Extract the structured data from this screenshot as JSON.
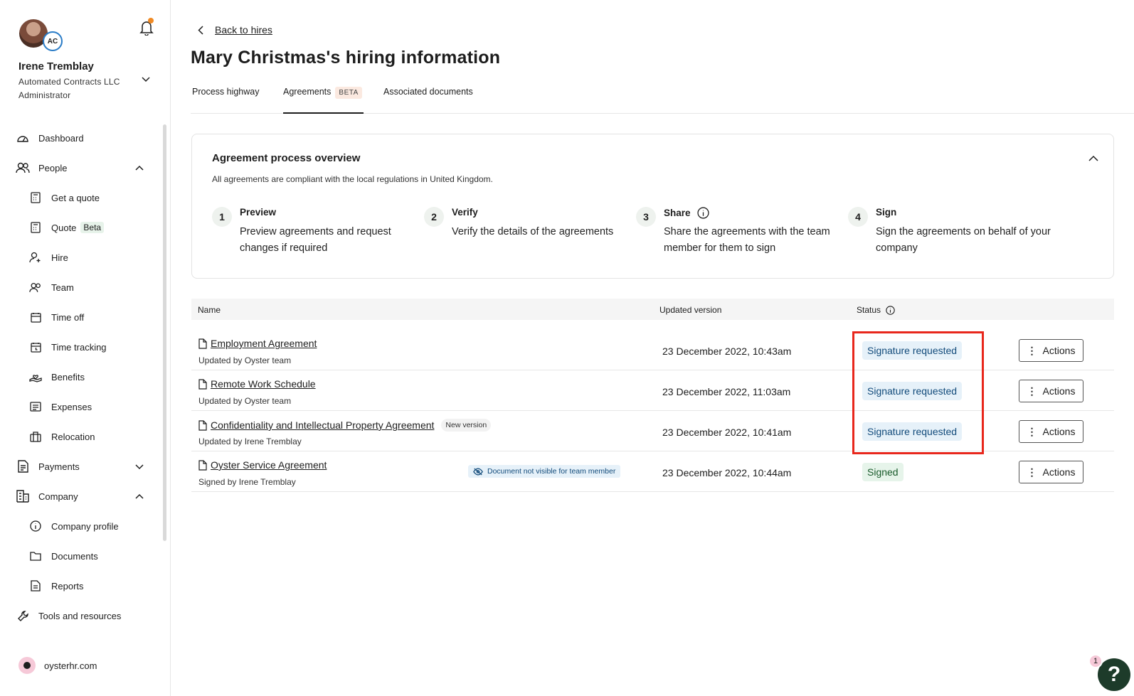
{
  "user": {
    "initials": "AC",
    "name": "Irene Tremblay",
    "company": "Automated Contracts LLC",
    "role": "Administrator"
  },
  "nav": {
    "dashboard": "Dashboard",
    "people": "People",
    "get_quote": "Get a quote",
    "quote": "Quote",
    "quote_badge": "Beta",
    "hire": "Hire",
    "team": "Team",
    "time_off": "Time off",
    "time_tracking": "Time tracking",
    "benefits": "Benefits",
    "expenses": "Expenses",
    "relocation": "Relocation",
    "payments": "Payments",
    "company": "Company",
    "company_profile": "Company profile",
    "documents": "Documents",
    "reports": "Reports",
    "tools": "Tools and resources"
  },
  "footer": {
    "site": "oysterhr.com"
  },
  "header": {
    "back_label": "Back to hires",
    "title": "Mary Christmas's hiring information"
  },
  "tabs": {
    "process": "Process highway",
    "agreements": "Agreements",
    "agreements_badge": "BETA",
    "associated": "Associated documents"
  },
  "overview": {
    "title": "Agreement process overview",
    "subtitle": "All agreements are compliant with the local regulations in United Kingdom.",
    "steps": [
      {
        "num": "1",
        "title": "Preview",
        "desc": "Preview agreements and request changes if required"
      },
      {
        "num": "2",
        "title": "Verify",
        "desc": "Verify the details of the agreements"
      },
      {
        "num": "3",
        "title": "Share",
        "desc": "Share the agreements with the team member for them to sign"
      },
      {
        "num": "4",
        "title": "Sign",
        "desc": "Sign the agreements on behalf of your company"
      }
    ]
  },
  "table": {
    "headers": {
      "name": "Name",
      "updated": "Updated version",
      "status": "Status"
    },
    "actions_label": "Actions",
    "rows": [
      {
        "name": "Employment Agreement",
        "by": "Updated by Oyster team",
        "date": "23 December 2022, 10:43am",
        "status": "Signature requested"
      },
      {
        "name": "Remote Work Schedule",
        "by": "Updated by Oyster team",
        "date": "23 December 2022, 11:03am",
        "status": "Signature requested"
      },
      {
        "name": "Confidentiality and Intellectual Property Agreement",
        "badge": "New version",
        "by": "Updated by Irene Tremblay",
        "date": "23 December 2022, 10:41am",
        "status": "Signature requested"
      },
      {
        "name": "Oyster Service Agreement",
        "badge": "Document not visible for team member",
        "by": "Signed by Irene Tremblay",
        "date": "23 December 2022, 10:44am",
        "status": "Signed"
      }
    ]
  },
  "help": {
    "badge_count": "1",
    "label": "?"
  },
  "colors": {
    "highlight": "#e8271c",
    "status_requested_bg": "#e6f1f9",
    "status_signed_bg": "#e6f4ea",
    "help_bg": "#1d3b2a"
  }
}
